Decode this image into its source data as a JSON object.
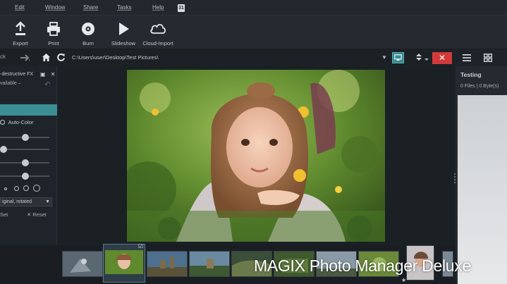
{
  "menu": {
    "items": [
      "Edit",
      "Window",
      "Share",
      "Tasks",
      "Help"
    ],
    "badge": "31"
  },
  "toolbar": {
    "export_label": "Export",
    "print_label": "Print",
    "burn_label": "Burn",
    "slideshow_label": "Slideshow",
    "cloud_label": "Cloud-Import"
  },
  "nav": {
    "back_label": "ck",
    "path": "C:\\Users\\user\\Desktop\\Test Pictures\\",
    "close_glyph": "✕"
  },
  "left_panel": {
    "title": "-destructive FX",
    "subtitle": "vailable –",
    "auto_color_label": "Auto-Color",
    "sliders": [
      0.47,
      0.0,
      0.47,
      0.47
    ],
    "select_value": "iginal, rotated",
    "set_label": "Set",
    "reset_label": "Reset"
  },
  "right_panel": {
    "title": "Testing",
    "summary": "0 Files | 0 Byte(s)"
  },
  "icons": {
    "export": "export-icon",
    "print": "print-icon",
    "burn": "disc-icon",
    "slideshow": "play-icon",
    "cloud": "cloud-icon",
    "home": "home-icon",
    "refresh": "refresh-icon",
    "list": "list-view-icon",
    "grid": "grid-view-icon"
  },
  "colors": {
    "accent": "#3b8e94",
    "close": "#d23a3a"
  },
  "filmstrip": {
    "thumbnail_count": 10,
    "selected_index": 1
  },
  "watermark": "MAGIX Photo Manager Deluxe"
}
